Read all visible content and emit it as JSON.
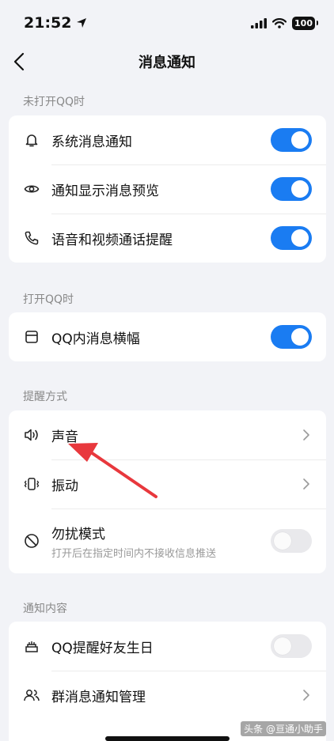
{
  "status_bar": {
    "time": "21:52",
    "battery": "100"
  },
  "nav": {
    "title": "消息通知"
  },
  "sections": [
    {
      "label": "未打开QQ时",
      "rows": [
        {
          "label": "系统消息通知",
          "icon": "bell-icon",
          "toggle": true
        },
        {
          "label": "通知显示消息预览",
          "icon": "eye-icon",
          "toggle": true
        },
        {
          "label": "语音和视频通话提醒",
          "icon": "phone-icon",
          "toggle": true
        }
      ]
    },
    {
      "label": "打开QQ时",
      "rows": [
        {
          "label": "QQ内消息横幅",
          "icon": "banner-icon",
          "toggle": true
        }
      ]
    },
    {
      "label": "提醒方式",
      "rows": [
        {
          "label": "声音",
          "icon": "speaker-icon",
          "chevron": true
        },
        {
          "label": "振动",
          "icon": "vibrate-icon",
          "chevron": true
        },
        {
          "label": "勿扰模式",
          "sub": "打开后在指定时间内不接收信息推送",
          "icon": "do-not-disturb-icon",
          "toggle": false
        }
      ]
    },
    {
      "label": "通知内容",
      "rows": [
        {
          "label": "QQ提醒好友生日",
          "icon": "cake-icon",
          "toggle": false
        },
        {
          "label": "群消息通知管理",
          "icon": "group-icon",
          "chevron": true
        }
      ]
    }
  ],
  "watermark": "头条 @亘通小助手",
  "colors": {
    "accent": "#1a7cf2",
    "annotation_arrow": "#e8383d"
  }
}
